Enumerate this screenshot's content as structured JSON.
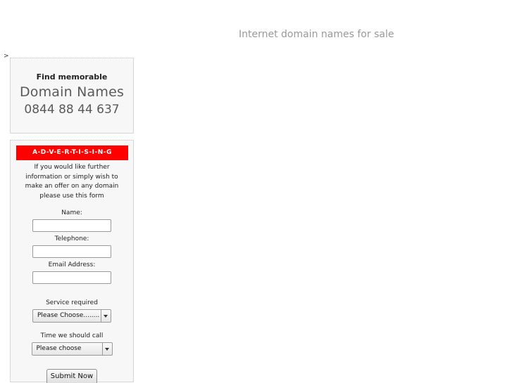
{
  "header": {
    "title": "Internet domain names for sale"
  },
  "stray_char": ">",
  "promo": {
    "line1": "Find memorable",
    "line2": "Domain Names",
    "phone": "0844 88 44 637"
  },
  "form": {
    "banner": "A-D-V-E-R-T-I-S-I-N-G",
    "banner_color": "#ff0000",
    "intro": "If you would like further information or simply wish to make an offer on any domain please use this form",
    "name_label": "Name:",
    "name_value": "",
    "telephone_label": "Telephone:",
    "telephone_value": "",
    "email_label": "Email Address:",
    "email_value": "",
    "service_label": "Service required",
    "service_selected": "Please Choose........",
    "time_label": "Time we should call",
    "time_selected": "Please choose",
    "submit_label": "Submit Now"
  }
}
